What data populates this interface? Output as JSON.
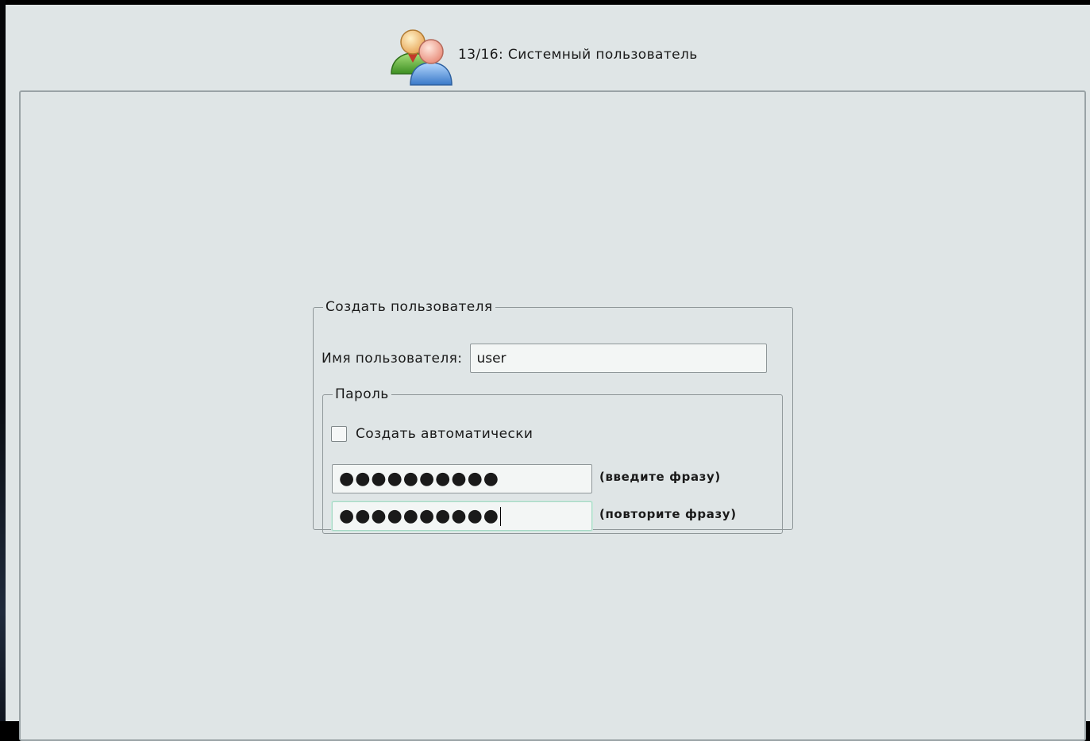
{
  "header": {
    "title": "13/16: Системный пользователь",
    "icon": "users-icon"
  },
  "create_user": {
    "legend": "Создать пользователя",
    "username_label": "Имя пользователя:",
    "username_value": "user",
    "password": {
      "legend": "Пароль",
      "auto_label": "Создать автоматически",
      "auto_checked": false,
      "password_mask": "●●●●●●●●●●",
      "password_hint": "(введите фразу)",
      "confirm_mask": "●●●●●●●●●●",
      "confirm_hint": "(повторите фразу)"
    }
  },
  "colors": {
    "window_bg": "#dfe5e6",
    "border": "#8f9799",
    "input_bg": "#f3f6f5",
    "focus_border": "#a8d8c6"
  }
}
